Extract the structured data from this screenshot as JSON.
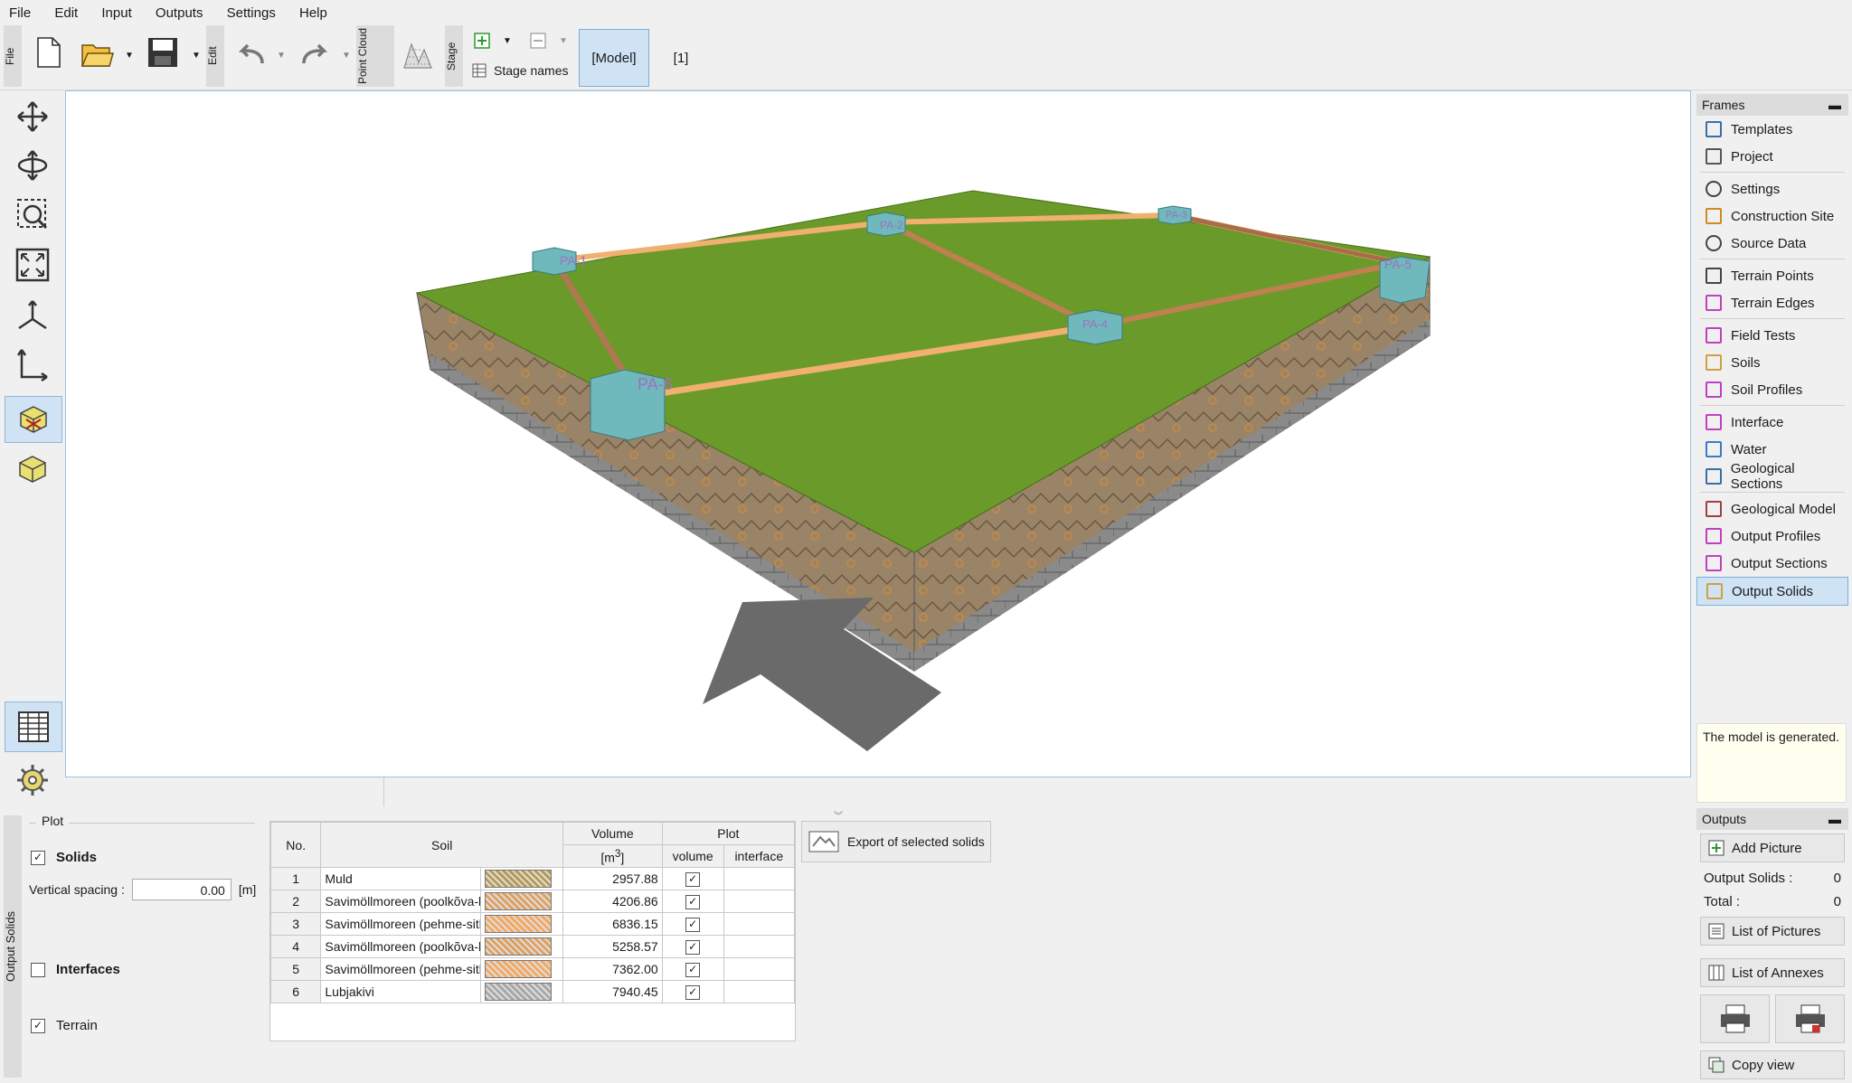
{
  "menu": [
    "File",
    "Edit",
    "Input",
    "Outputs",
    "Settings",
    "Help"
  ],
  "toolbar": {
    "file_tab": "File",
    "edit_tab": "Edit",
    "point_cloud_tab": "Point Cloud",
    "stage_tab": "Stage",
    "stage_names_label": "Stage names",
    "model_button": "[Model]",
    "stage_one": "[1]"
  },
  "frames": {
    "title": "Frames",
    "groups": [
      [
        {
          "label": "Templates",
          "icon": "templates-icon"
        },
        {
          "label": "Project",
          "icon": "project-icon"
        }
      ],
      [
        {
          "label": "Settings",
          "icon": "gear-icon"
        },
        {
          "label": "Construction Site",
          "icon": "construction-site-icon"
        },
        {
          "label": "Source Data",
          "icon": "globe-icon"
        }
      ],
      [
        {
          "label": "Terrain Points",
          "icon": "terrain-points-icon"
        },
        {
          "label": "Terrain Edges",
          "icon": "terrain-edges-icon"
        }
      ],
      [
        {
          "label": "Field Tests",
          "icon": "field-tests-icon"
        },
        {
          "label": "Soils",
          "icon": "soils-icon"
        },
        {
          "label": "Soil Profiles",
          "icon": "soil-profiles-icon"
        }
      ],
      [
        {
          "label": "Interface",
          "icon": "interface-icon"
        },
        {
          "label": "Water",
          "icon": "water-icon"
        },
        {
          "label": "Geological Sections",
          "icon": "geological-sections-icon"
        }
      ],
      [
        {
          "label": "Geological Model",
          "icon": "geological-model-icon"
        },
        {
          "label": "Output Profiles",
          "icon": "output-profiles-icon"
        },
        {
          "label": "Output Sections",
          "icon": "output-sections-icon"
        },
        {
          "label": "Output Solids",
          "icon": "output-solids-icon"
        }
      ]
    ]
  },
  "status_message": "The model is generated.",
  "viewport": {
    "labels": [
      "PA-1",
      "PA-2",
      "PA-3",
      "PA-4",
      "PA-5",
      "PA-6"
    ]
  },
  "plot_panel": {
    "side_label": "Output Solids",
    "group_label": "Plot",
    "solids_label": "Solids",
    "vertical_spacing_label": "Vertical spacing :",
    "vertical_spacing_value": "0.00",
    "vertical_spacing_unit": "[m]",
    "interfaces_label": "Interfaces",
    "terrain_label": "Terrain"
  },
  "table": {
    "headers": {
      "no": "No.",
      "soil": "Soil",
      "volume": "Volume",
      "volume_unit": "[m",
      "volume_unit_exp": "3",
      "volume_unit_close": "]",
      "plot": "Plot",
      "plot_volume": "volume",
      "plot_interface": "interface"
    },
    "rows": [
      {
        "no": "1",
        "soil": "Muld",
        "color": "#b89b52",
        "volume": "2957.88",
        "checked": true
      },
      {
        "no": "2",
        "soil": "Savimöllmoreen (poolkõva-kõva",
        "color": "#e0a060",
        "volume": "4206.86",
        "checked": true
      },
      {
        "no": "3",
        "soil": "Savimöllmoreen (pehme-sitke)",
        "color": "#f4a860",
        "volume": "6836.15",
        "checked": true
      },
      {
        "no": "4",
        "soil": "Savimöllmoreen (poolkõva-kõva",
        "color": "#e0a060",
        "volume": "5258.57",
        "checked": true
      },
      {
        "no": "5",
        "soil": "Savimöllmoreen (pehme-sitke)",
        "color": "#f4a860",
        "volume": "7362.00",
        "checked": true
      },
      {
        "no": "6",
        "soil": "Lubjakivi",
        "color": "#a8a8a8",
        "volume": "7940.45",
        "checked": true
      }
    ]
  },
  "export_button": "Export of selected solids",
  "outputs": {
    "title": "Outputs",
    "add_picture": "Add Picture",
    "output_solids_label": "Output Solids :",
    "output_solids_value": "0",
    "total_label": "Total :",
    "total_value": "0",
    "list_of_pictures": "List of Pictures",
    "list_of_annexes": "List of Annexes",
    "copy_view": "Copy view"
  },
  "colors": {
    "grass": "#6a9a2a",
    "soil": "#9a8060",
    "road": "#f0b070",
    "box": "#6fb8bc",
    "accent": "#cfe3f5"
  }
}
